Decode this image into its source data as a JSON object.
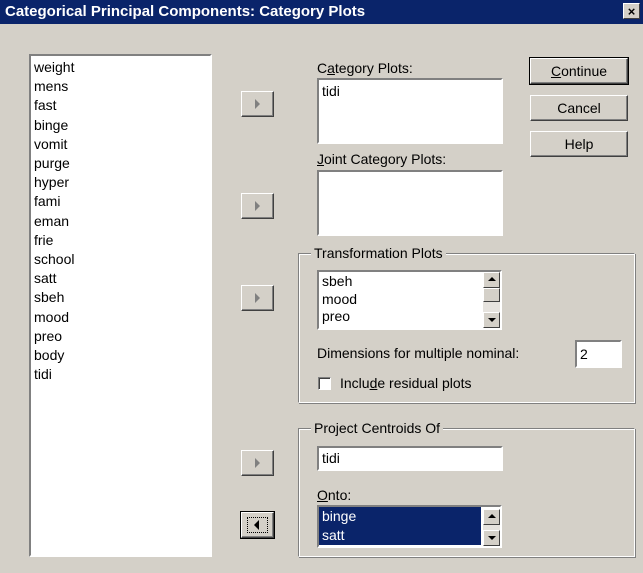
{
  "window": {
    "title": "Categorical Principal Components: Category Plots",
    "close_glyph": "×"
  },
  "variables": [
    "weight",
    "mens",
    "fast",
    "binge",
    "vomit",
    "purge",
    "hyper",
    "fami",
    "eman",
    "frie",
    "school",
    "satt",
    "sbeh",
    "mood",
    "preo",
    "body",
    "tidi"
  ],
  "category_plots": {
    "label_pre": "C",
    "label_u": "a",
    "label_post": "tegory Plots:",
    "items": [
      "tidi"
    ]
  },
  "joint_category_plots": {
    "label_pre": "",
    "label_u": "J",
    "label_post": "oint Category Plots:",
    "items": []
  },
  "transformation_plots": {
    "title": "Transformation Plots",
    "items": [
      "sbeh",
      "mood",
      "preo"
    ],
    "dimensions_label": "Dimensions for multiple nominal:",
    "dimensions_value": "2",
    "residual_pre": "Inclu",
    "residual_u": "d",
    "residual_post": "e residual plots",
    "residual_checked": false
  },
  "project_centroids": {
    "title": "Project Centroids Of",
    "value": "tidi",
    "onto_u": "O",
    "onto_post": "nto:",
    "onto_items": [
      "binge",
      "satt"
    ]
  },
  "buttons": {
    "continue_u": "C",
    "continue_post": "ontinue",
    "cancel": "Cancel",
    "help": "Help"
  },
  "icons": {
    "move_right": "arrow-right-icon",
    "move_left": "arrow-left-icon",
    "scroll_up": "scroll-up-icon",
    "scroll_down": "scroll-down-icon",
    "close": "close-icon"
  },
  "colors": {
    "title_bar": "#0a246a",
    "face": "#d4d0c8",
    "selection": "#0a246a"
  }
}
